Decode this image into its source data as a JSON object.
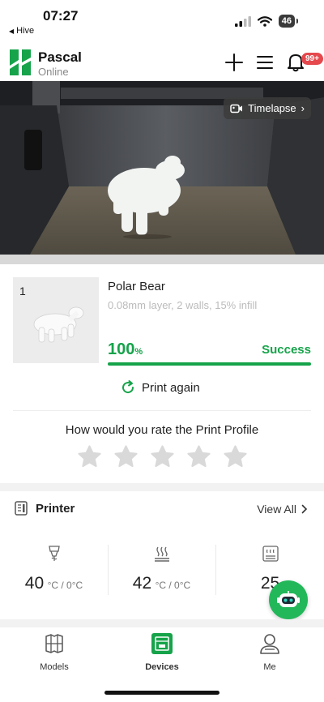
{
  "status_bar": {
    "time": "07:27",
    "back_app": "Hive",
    "battery": "46"
  },
  "header": {
    "printer_name": "Pascal",
    "printer_status": "Online",
    "notification_badge": "99+"
  },
  "camera": {
    "timelapse_label": "Timelapse"
  },
  "job": {
    "index": "1",
    "name": "Polar Bear",
    "description": "0.08mm layer, 2 walls, 15% infill",
    "progress_value": "100",
    "progress_unit": "%",
    "progress_fraction": 1.0,
    "status": "Success",
    "print_again_label": "Print again"
  },
  "rating": {
    "title": "How would you rate the Print Profile",
    "stars_filled": 0,
    "stars_total": 5
  },
  "printer_section": {
    "title": "Printer",
    "view_all_label": "View All",
    "temps": [
      {
        "icon": "nozzle-temp-icon",
        "value": "40",
        "unit": "°C / 0°C"
      },
      {
        "icon": "bed-temp-icon",
        "value": "42",
        "unit": "°C / 0°C"
      },
      {
        "icon": "chamber-temp-icon",
        "value": "25",
        "unit": ""
      }
    ]
  },
  "tabbar": {
    "tabs": [
      {
        "label": "Models",
        "icon": "models-icon"
      },
      {
        "label": "Devices",
        "icon": "devices-icon",
        "active": true
      },
      {
        "label": "Me",
        "icon": "me-icon"
      }
    ]
  },
  "colors": {
    "accent_green": "#16a34a",
    "badge_red": "#e5484d",
    "assistant_green": "#22b85a"
  }
}
